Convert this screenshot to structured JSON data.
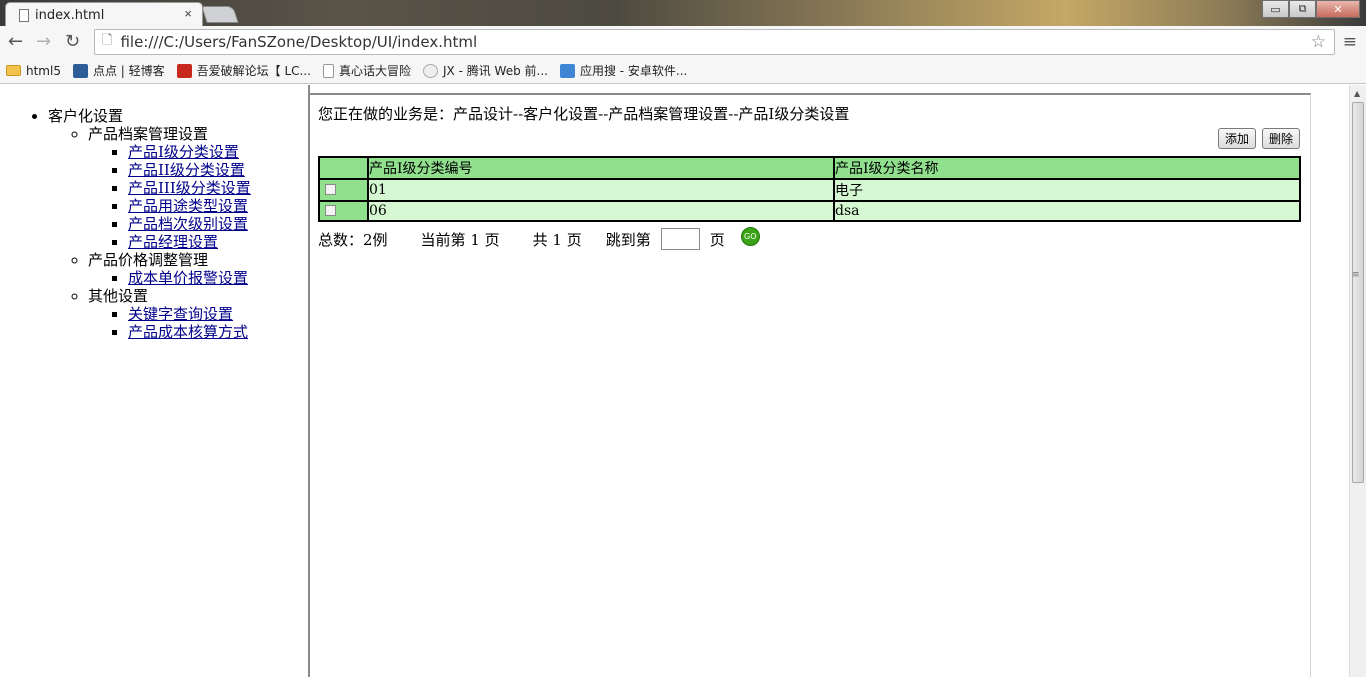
{
  "browser": {
    "tab_title": "index.html",
    "tab_close": "×",
    "url": "file:///C:/Users/FanSZone/Desktop/UI/index.html",
    "window_buttons": {
      "minimize": "▭",
      "restore": "⧉",
      "close": "✕"
    },
    "nav": {
      "back": "←",
      "forward": "→",
      "reload": "↻",
      "star": "☆",
      "menu": "≡"
    },
    "bookmarks": [
      {
        "label": "html5",
        "icon": "folder-icon"
      },
      {
        "label": "点点 | 轻博客",
        "icon": "diandian-icon"
      },
      {
        "label": "吾爱破解论坛【 LC...",
        "icon": "52pojie-icon"
      },
      {
        "label": "真心话大冒险",
        "icon": "page-icon"
      },
      {
        "label": "JX - 腾讯 Web 前...",
        "icon": "egg-icon"
      },
      {
        "label": "应用搜 - 安卓软件...",
        "icon": "search-icon"
      }
    ]
  },
  "sidebar": {
    "root_label": "客户化设置",
    "groups": [
      {
        "label": "产品档案管理设置",
        "items": [
          "产品I级分类设置",
          "产品II级分类设置",
          "产品III级分类设置",
          "产品用途类型设置",
          "产品档次级别设置",
          "产品经理设置"
        ]
      },
      {
        "label": "产品价格调整管理",
        "items": [
          "成本单价报警设置"
        ]
      },
      {
        "label": "其他设置",
        "items": [
          "关键字查询设置",
          "产品成本核算方式"
        ]
      }
    ]
  },
  "main": {
    "breadcrumb": "您正在做的业务是：产品设计--客户化设置--产品档案管理设置--产品I级分类设置",
    "add_label": "添加",
    "delete_label": "删除",
    "table": {
      "headers": [
        "产品I级分类编号",
        "产品I级分类名称"
      ],
      "rows": [
        {
          "code": "01",
          "name": "电子"
        },
        {
          "code": "06",
          "name": "dsa"
        }
      ]
    },
    "pager": {
      "total_label": "总数：2例",
      "current_label": "当前第 1 页",
      "pages_label": "共 1 页",
      "jump_prefix": "跳到第",
      "jump_suffix": "页",
      "go_label": "GO"
    }
  },
  "colors": {
    "header_green": "#90e08e",
    "row_green": "#d5f8d3",
    "link_blue": "#00008b",
    "go_green": "#3aa215"
  }
}
